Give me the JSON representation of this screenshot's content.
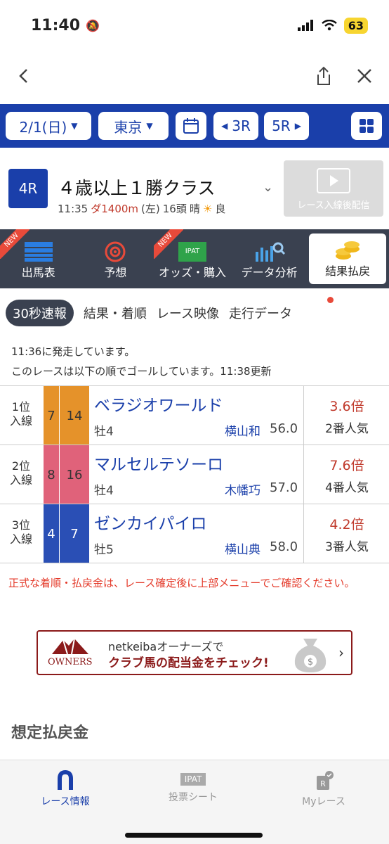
{
  "status": {
    "time": "11:40",
    "battery": "63"
  },
  "date": "2/1(日)",
  "venue": "東京",
  "prev": "3R",
  "next": "5R",
  "race": {
    "num": "4R",
    "title": "４歳以上１勝クラス",
    "time": "11:35",
    "course": "ダ1400m",
    "dir": "(左)",
    "heads": "16頭",
    "weather": "晴",
    "going": "良",
    "video": "レース入線後配信"
  },
  "tabs": [
    {
      "label": "出馬表",
      "new": "NEW"
    },
    {
      "label": "予想",
      "new": ""
    },
    {
      "label": "オッズ・購入",
      "new": "NEW"
    },
    {
      "label": "データ分析",
      "new": ""
    },
    {
      "label": "結果払戻",
      "new": ""
    }
  ],
  "subtabs": [
    "30秒速報",
    "結果・着順",
    "レース映像",
    "走行データ"
  ],
  "info": {
    "line1": "11:36に発走しています。",
    "line2": "このレースは以下の順でゴールしています。11:38更新"
  },
  "results": [
    {
      "pos1": "1位",
      "pos2": "入線",
      "waku": "7",
      "num": "14",
      "name": "ベラジオワールド",
      "sex": "牡4",
      "jockey": "横山和",
      "weight": "56.0",
      "odds": "3.6倍",
      "pop": "2番人気",
      "color": "#e5922a"
    },
    {
      "pos1": "2位",
      "pos2": "入線",
      "waku": "8",
      "num": "16",
      "name": "マルセルテソーロ",
      "sex": "牡4",
      "jockey": "木幡巧",
      "weight": "57.0",
      "odds": "7.6倍",
      "pop": "4番人気",
      "color": "#e0627a"
    },
    {
      "pos1": "3位",
      "pos2": "入線",
      "waku": "4",
      "num": "7",
      "name": "ゼンカイパイロ",
      "sex": "牡5",
      "jockey": "横山典",
      "weight": "58.0",
      "odds": "4.2倍",
      "pop": "3番人気",
      "color": "#2a4fb5"
    }
  ],
  "note": "正式な着順・払戻金は、レース確定後に上部メニューでご確認ください。",
  "banner": {
    "logo": "OWNERS",
    "line1": "netkeibaオーナーズで",
    "line2": "クラブ馬の配当金をチェック!"
  },
  "section": "想定払戻金",
  "bottom": {
    "item1": "レース情報",
    "item2": "投票シート",
    "item3": "Myレース",
    "ipat": "IPAT"
  }
}
